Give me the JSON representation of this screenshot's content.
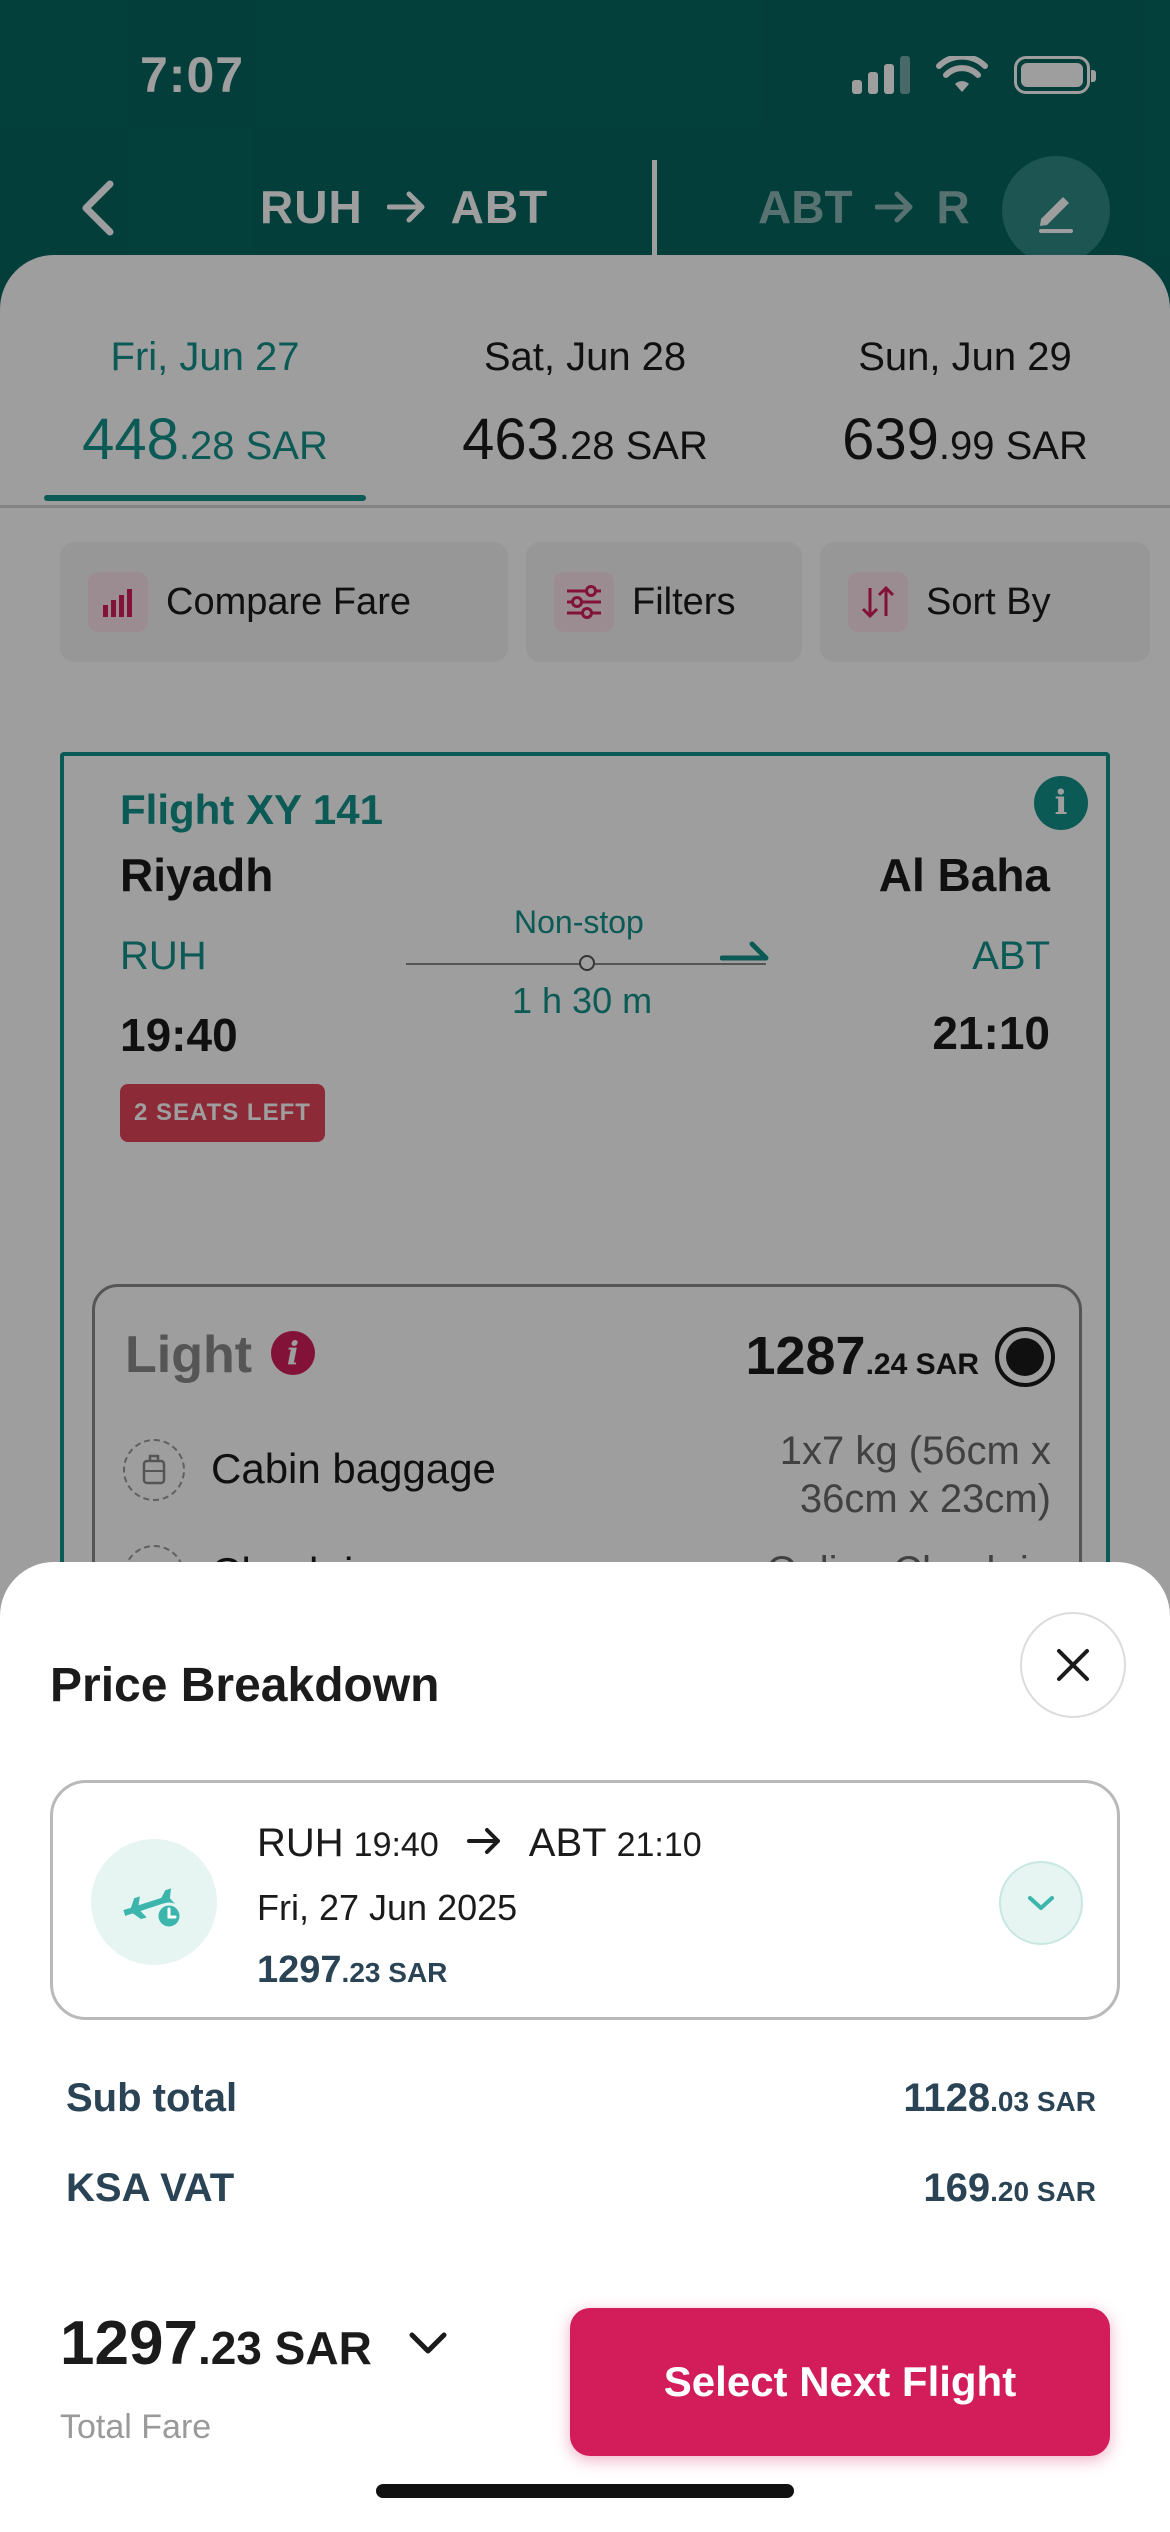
{
  "status_bar": {
    "time": "7:07"
  },
  "header": {
    "route1": {
      "from": "RUH",
      "to": "ABT"
    },
    "route2": {
      "from": "ABT",
      "to": "R"
    }
  },
  "dates": [
    {
      "label": "Fri, Jun 27",
      "price_int": "448",
      "price_dec": ".28",
      "currency": "SAR",
      "active": true
    },
    {
      "label": "Sat, Jun 28",
      "price_int": "463",
      "price_dec": ".28",
      "currency": "SAR",
      "active": false
    },
    {
      "label": "Sun, Jun 29",
      "price_int": "639",
      "price_dec": ".99",
      "currency": "SAR",
      "active": false
    }
  ],
  "chips": {
    "compare": "Compare Fare",
    "filters": "Filters",
    "sort": "Sort By"
  },
  "flight": {
    "number": "Flight XY 141",
    "from_city": "Riyadh",
    "to_city": "Al Baha",
    "from_code": "RUH",
    "to_code": "ABT",
    "depart": "19:40",
    "arrive": "21:10",
    "stops": "Non-stop",
    "duration": "1 h 30 m",
    "seats_badge": "2 SEATS LEFT",
    "fare": {
      "name": "Light",
      "price_int": "1287",
      "price_dec": ".24",
      "currency": "SAR",
      "row1_label": "Cabin baggage",
      "row1_value": "1x7 kg (56cm x 36cm x 23cm)",
      "row2_label": "Check-in",
      "row2_value": "Online Check-in"
    }
  },
  "breakdown": {
    "title": "Price Breakdown",
    "segment": {
      "from": "RUH",
      "depart": "19:40",
      "to": "ABT",
      "arrive": "21:10",
      "date": "Fri, 27 Jun 2025",
      "price_int": "1297",
      "price_dec": ".23",
      "currency": "SAR"
    },
    "subtotal_label": "Sub total",
    "subtotal_int": "1128",
    "subtotal_dec": ".03",
    "vat_label": "KSA VAT",
    "vat_int": "169",
    "vat_dec": ".20",
    "currency": "SAR"
  },
  "footer": {
    "total_int": "1297",
    "total_dec": ".23",
    "total_currency": "SAR",
    "total_label": "Total Fare",
    "select_button": "Select Next Flight"
  },
  "colors": {
    "teal": "#05655f",
    "accent_teal": "#14918a",
    "primary_pink": "#d31d5b",
    "badge_red": "#e3455a"
  }
}
